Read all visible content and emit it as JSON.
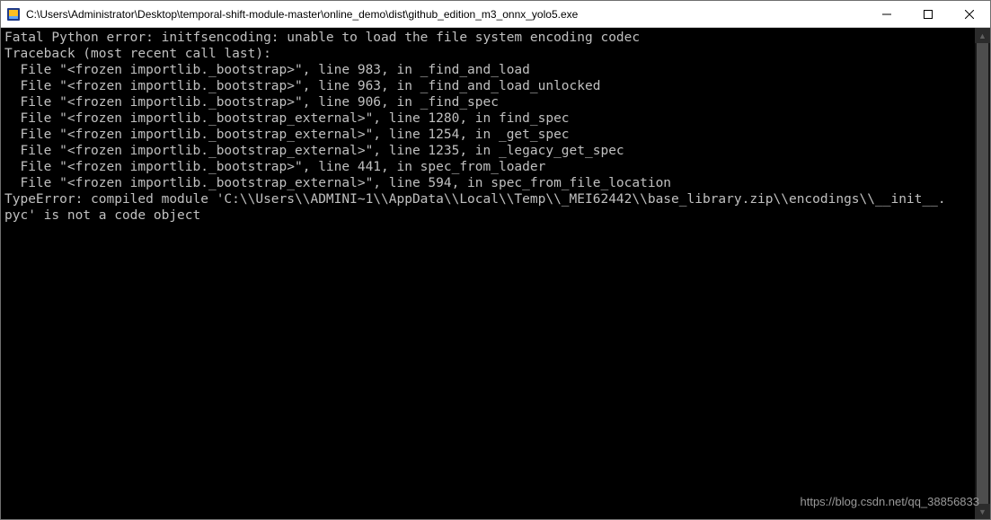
{
  "titlebar": {
    "title": "C:\\Users\\Administrator\\Desktop\\temporal-shift-module-master\\online_demo\\dist\\github_edition_m3_onnx_yolo5.exe"
  },
  "console": {
    "lines": [
      "Fatal Python error: initfsencoding: unable to load the file system encoding codec",
      "Traceback (most recent call last):",
      "  File \"<frozen importlib._bootstrap>\", line 983, in _find_and_load",
      "  File \"<frozen importlib._bootstrap>\", line 963, in _find_and_load_unlocked",
      "  File \"<frozen importlib._bootstrap>\", line 906, in _find_spec",
      "  File \"<frozen importlib._bootstrap_external>\", line 1280, in find_spec",
      "  File \"<frozen importlib._bootstrap_external>\", line 1254, in _get_spec",
      "  File \"<frozen importlib._bootstrap_external>\", line 1235, in _legacy_get_spec",
      "  File \"<frozen importlib._bootstrap>\", line 441, in spec_from_loader",
      "  File \"<frozen importlib._bootstrap_external>\", line 594, in spec_from_file_location",
      "TypeError: compiled module 'C:\\\\Users\\\\ADMINI~1\\\\AppData\\\\Local\\\\Temp\\\\_MEI62442\\\\base_library.zip\\\\encodings\\\\__init__.",
      "pyc' is not a code object"
    ]
  },
  "watermark": "https://blog.csdn.net/qq_38856833"
}
